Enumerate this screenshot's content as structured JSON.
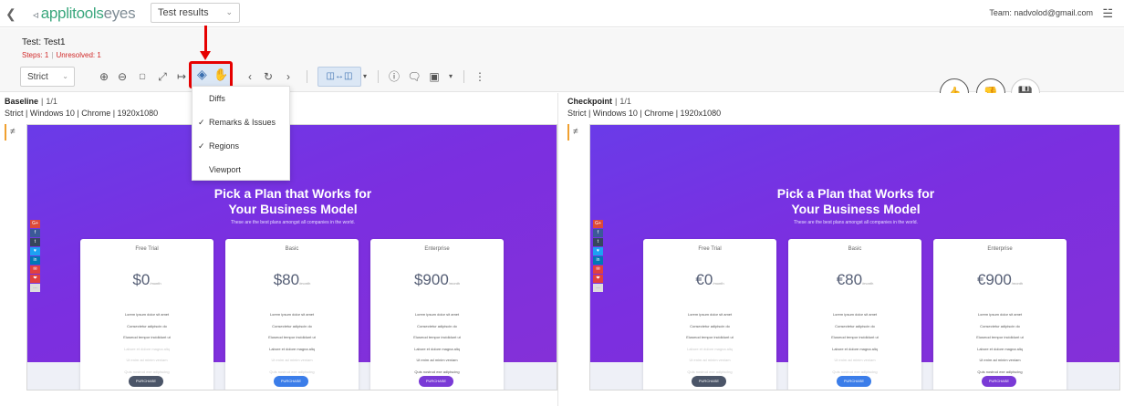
{
  "app": {
    "logo_main": "applitools",
    "logo_sub": "eyes",
    "view_select": "Test results",
    "team": "Team: nadvolod@gmail.com"
  },
  "test": {
    "title": "Test: Test1",
    "steps": "Steps: 1",
    "unresolved": "Unresolved: 1"
  },
  "toolbar": {
    "match_level": "Strict"
  },
  "layers_menu": {
    "items": [
      {
        "label": "Diffs",
        "checked": false
      },
      {
        "label": "Remarks & Issues",
        "checked": true
      },
      {
        "label": "Regions",
        "checked": true
      },
      {
        "label": "Viewport",
        "checked": false
      }
    ]
  },
  "baseline": {
    "title": "Baseline",
    "count": "1/1",
    "meta": "Strict | Windows 10 | Chrome | 1920x1080"
  },
  "checkpoint": {
    "title": "Checkpoint",
    "count": "1/1",
    "meta": "Strict | Windows 10 | Chrome | 1920x1080"
  },
  "page": {
    "heading_line1": "Pick a Plan that Works for",
    "heading_line2": "Your Business Model",
    "subheading": "These are the best plans amongst all companies in the world.",
    "per": "/month",
    "features": [
      "Lorem ipsum dolor sit amet",
      "Consectetur adipiscin do",
      "Eiusmod tempor incididunt ut",
      "Labore et dolore magna aliq",
      "Ut enim ad minim veniam",
      "Quis nostrud exe adipiscing"
    ],
    "plans": [
      {
        "name": "Free Trial",
        "button": "PURCHASE",
        "light_from": 3
      },
      {
        "name": "Basic",
        "button": "PURCHASE",
        "light_from": 4
      },
      {
        "name": "Enterprise",
        "button": "PURCHASE",
        "light_from": 6
      }
    ],
    "baseline_prices": [
      "$0",
      "$80",
      "$900"
    ],
    "checkpoint_prices": [
      "€0",
      "€80",
      "€900"
    ]
  }
}
